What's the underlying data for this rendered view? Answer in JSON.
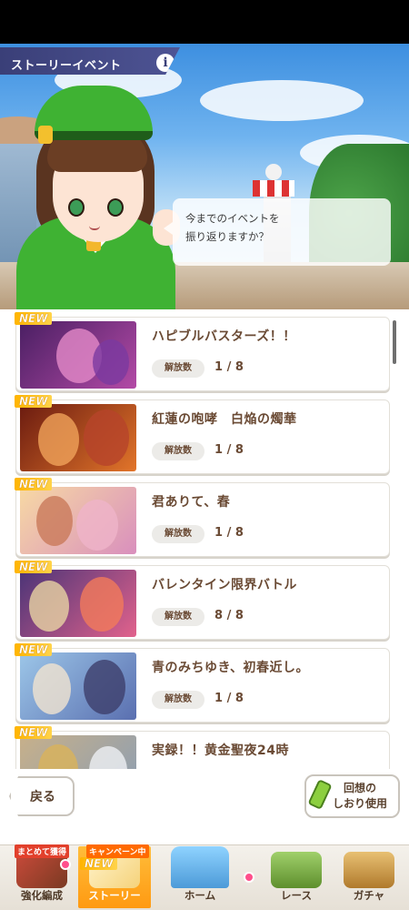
{
  "header": {
    "title": "ストーリーイベント",
    "info_icon": "info-icon"
  },
  "speech": {
    "line1": "今までのイベントを",
    "line2": "振り返りますか？"
  },
  "events": [
    {
      "title": "ハピブルバスターズ！！",
      "new_tag": "NEW",
      "status_label": "解放数",
      "progress": "1 / 8",
      "colors": [
        "#4a1f63",
        "#b34aa6"
      ]
    },
    {
      "title": "紅蓮の咆哮　白焔の燭華",
      "new_tag": "NEW",
      "status_label": "解放数",
      "progress": "1 / 8",
      "colors": [
        "#6b1b10",
        "#e2752a"
      ]
    },
    {
      "title": "君ありて、春",
      "new_tag": "NEW",
      "status_label": "解放数",
      "progress": "1 / 8",
      "colors": [
        "#f7d9a4",
        "#d98fbd"
      ]
    },
    {
      "title": "バレンタイン限界バトル",
      "new_tag": "NEW",
      "status_label": "解放数",
      "progress": "8 / 8",
      "colors": [
        "#4b3477",
        "#e1628c"
      ]
    },
    {
      "title": "青のみちゆき、初春近し。",
      "new_tag": "NEW",
      "status_label": "解放数",
      "progress": "1 / 8",
      "colors": [
        "#9cc6e8",
        "#5a6fb0"
      ]
    },
    {
      "title": "実録！！黄金聖夜24時",
      "new_tag": "NEW",
      "status_label": "",
      "progress": "",
      "colors": [
        "#c7b08a",
        "#8a9db4"
      ]
    }
  ],
  "buttons": {
    "back": "戻る",
    "memory_line1": "回想の",
    "memory_line2": "しおり使用"
  },
  "nav": {
    "items": [
      {
        "label": "強化編成",
        "promo": "まとめて獲得"
      },
      {
        "label": "ストーリー",
        "promo": "キャンペーン中",
        "new_tag": "NEW"
      },
      {
        "label": "ホーム"
      },
      {
        "label": "レース"
      },
      {
        "label": "ガチャ"
      }
    ]
  }
}
